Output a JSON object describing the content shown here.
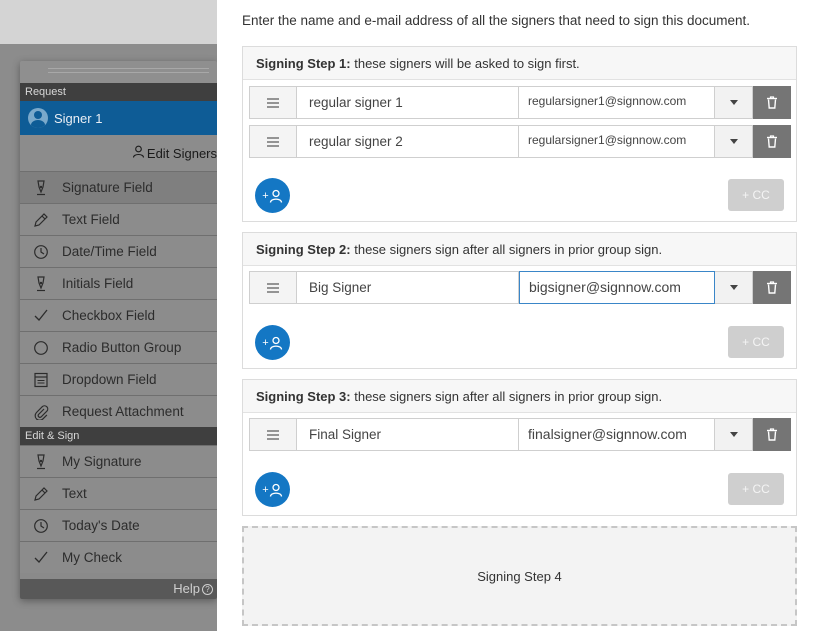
{
  "sidebar": {
    "section_request": "Request",
    "signer_label": "Signer 1",
    "edit_signers_label": "Edit Signers",
    "request_items": [
      {
        "label": "Signature Field",
        "icon": "pen-nib-icon"
      },
      {
        "label": "Text Field",
        "icon": "pencil-icon"
      },
      {
        "label": "Date/Time Field",
        "icon": "clock-icon"
      },
      {
        "label": "Initials Field",
        "icon": "pen-nib-icon"
      },
      {
        "label": "Checkbox Field",
        "icon": "check-icon"
      },
      {
        "label": "Radio Button Group",
        "icon": "radio-circle-icon"
      },
      {
        "label": "Dropdown Field",
        "icon": "dropdown-list-icon"
      },
      {
        "label": "Request Attachment",
        "icon": "paperclip-icon"
      }
    ],
    "section_edit_sign": "Edit & Sign",
    "edit_sign_items": [
      {
        "label": "My Signature",
        "icon": "pen-nib-icon"
      },
      {
        "label": "Text",
        "icon": "pencil-icon"
      },
      {
        "label": "Today's Date",
        "icon": "clock-icon"
      },
      {
        "label": "My Check",
        "icon": "check-icon"
      }
    ],
    "help_label": "Help"
  },
  "modal": {
    "intro": "Enter the name and e-mail address of all the signers that need to sign this document.",
    "steps": [
      {
        "title": "Signing Step 1:",
        "description": " these signers will be asked to sign first.",
        "signers": [
          {
            "name": "regular signer 1",
            "email": "regularsigner1@signnow.com"
          },
          {
            "name": "regular signer 2",
            "email": "regularsigner1@signnow.com"
          }
        ],
        "add_label": "+",
        "cc_label": "+ CC"
      },
      {
        "title": "Signing Step 2:",
        "description": " these signers sign after all signers in prior group sign.",
        "signers": [
          {
            "name": "Big Signer",
            "email": "bigsigner@signnow.com"
          }
        ],
        "add_label": "+",
        "cc_label": "+ CC"
      },
      {
        "title": "Signing Step 3:",
        "description": " these signers sign after all signers in prior group sign.",
        "signers": [
          {
            "name": "Final Signer",
            "email": "finalsigner@signnow.com"
          }
        ],
        "add_label": "+",
        "cc_label": "+ CC"
      }
    ],
    "step4_label": "Signing Step 4"
  },
  "colors": {
    "accent_blue": "#1477c4",
    "signer_highlight": "#0e5c96",
    "trash_gray": "#757575",
    "disabled_cc": "#cfcfcf"
  }
}
